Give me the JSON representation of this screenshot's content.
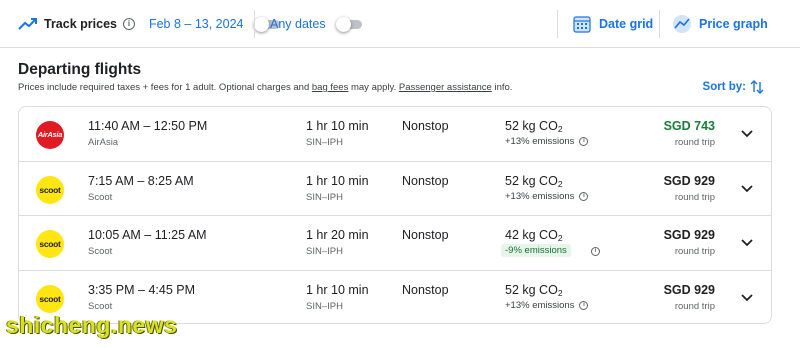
{
  "toolbar": {
    "track_prices_label": "Track prices",
    "date_range": "Feb 8 – 13, 2024",
    "any_dates_label": "Any dates",
    "date_grid_label": "Date grid",
    "price_graph_label": "Price graph"
  },
  "section": {
    "title": "Departing flights",
    "subline_prefix": "Prices include required taxes + fees for 1 adult. Optional charges and ",
    "bag_fees_link": "bag fees",
    "subline_mid": " may apply. ",
    "assistance_link": "Passenger assistance",
    "subline_suffix": " info.",
    "sort_label": "Sort by:"
  },
  "flights": [
    {
      "logo_text": "AirAsia",
      "times": "11:40 AM – 12:50 PM",
      "airline": "AirAsia",
      "duration": "1 hr 10 min",
      "route": "SIN–IPH",
      "stops": "Nonstop",
      "co2_value": "52 kg CO",
      "co2_sub": "2",
      "emissions": "+13% emissions",
      "price": "SGD 743",
      "trip_type": "round trip"
    },
    {
      "logo_text": "scoot",
      "times": "7:15 AM – 8:25 AM",
      "airline": "Scoot",
      "duration": "1 hr 10 min",
      "route": "SIN–IPH",
      "stops": "Nonstop",
      "co2_value": "52 kg CO",
      "co2_sub": "2",
      "emissions": "+13% emissions",
      "price": "SGD 929",
      "trip_type": "round trip"
    },
    {
      "logo_text": "scoot",
      "times": "10:05 AM – 11:25 AM",
      "airline": "Scoot",
      "duration": "1 hr 20 min",
      "route": "SIN–IPH",
      "stops": "Nonstop",
      "co2_value": "42 kg CO",
      "co2_sub": "2",
      "emissions": "-9% emissions",
      "price": "SGD 929",
      "trip_type": "round trip"
    },
    {
      "logo_text": "scoot",
      "times": "3:35 PM – 4:45 PM",
      "airline": "Scoot",
      "duration": "1 hr 10 min",
      "route": "SIN–IPH",
      "stops": "Nonstop",
      "co2_value": "52 kg CO",
      "co2_sub": "2",
      "emissions": "+13% emissions",
      "price": "SGD 929",
      "trip_type": "round trip"
    }
  ],
  "watermark": "shicheng.news",
  "colors": {
    "accent": "#1a73e8",
    "best_price": "#188038",
    "low_emissions_bg": "#e6f4ea",
    "airasia_red": "#e11b23",
    "scoot_yellow": "#ffe511"
  },
  "icons": {
    "track": "trending-up-icon",
    "grid": "calendar-grid-icon",
    "graph": "line-graph-icon",
    "sort": "sort-arrows-icon",
    "expand": "chevron-down-icon"
  }
}
